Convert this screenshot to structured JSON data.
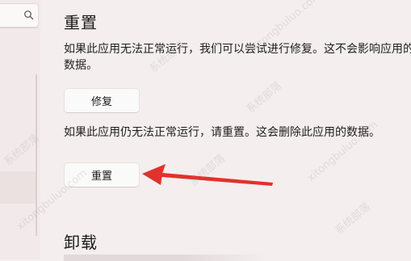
{
  "sidebar": {
    "search_icon": "search-icon"
  },
  "reset_section": {
    "title": "重置",
    "repair_description": "如果此应用无法正常运行，我们可以尝试进行修复。这不会影响应用的数据。",
    "repair_button_label": "修复",
    "reset_description": "如果此应用仍无法正常运行，请重置。这会删除此应用的数据。",
    "reset_button_label": "重置"
  },
  "uninstall_section": {
    "title": "卸载"
  },
  "annotation": {
    "arrow_color": "#e3312b",
    "target": "reset-button"
  },
  "watermark": {
    "text_a": "系统部落",
    "text_b": "xitongbuluo.com"
  },
  "colors": {
    "background": "#f5eeee",
    "button_bg": "#fbfafa",
    "arrow": "#e3312b"
  }
}
